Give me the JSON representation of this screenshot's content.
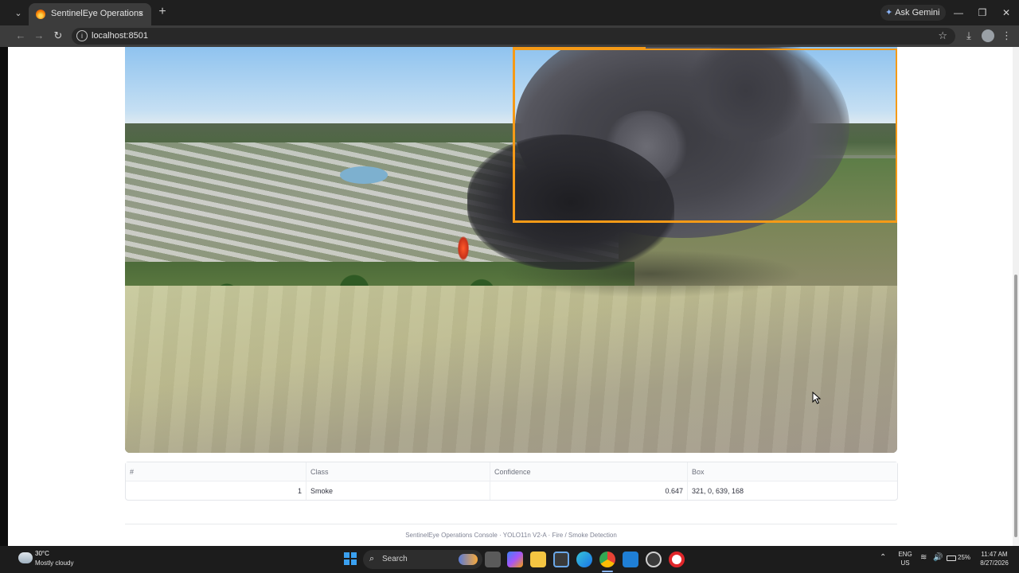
{
  "browser": {
    "tab_title": "SentinelEye Operations",
    "tab_close": "×",
    "new_tab": "+",
    "tab_list": "⌄",
    "gemini_label": "Ask Gemini",
    "gemini_icon": "✦",
    "url": "localhost:8501",
    "back": "←",
    "forward": "→",
    "reload": "↻",
    "info": "i",
    "star": "☆",
    "download": "⤓",
    "menu": "⋮",
    "minimize": "—",
    "restore": "❐",
    "close": "✕"
  },
  "detections": {
    "columns": [
      "#",
      "Class",
      "Confidence",
      "Box"
    ],
    "rows": [
      {
        "index": "1",
        "class": "Smoke",
        "confidence": "0.647",
        "box": "321, 0, 639, 168"
      }
    ],
    "box_color": "#f59a17"
  },
  "footer": {
    "text": "SentinelEye Operations Console · YOLO11n V2-A · Fire / Smoke Detection"
  },
  "taskbar": {
    "weather_temp": "30°C",
    "weather_desc": "Mostly cloudy",
    "search_label": "Search",
    "search_icon": "⌕",
    "lang_line1": "ENG",
    "lang_line2": "US",
    "tray_up": "⌃",
    "wifi": "≋",
    "volume": "🔊",
    "battery": "25%",
    "time": "11:47 AM",
    "date": "8/27/2026"
  }
}
